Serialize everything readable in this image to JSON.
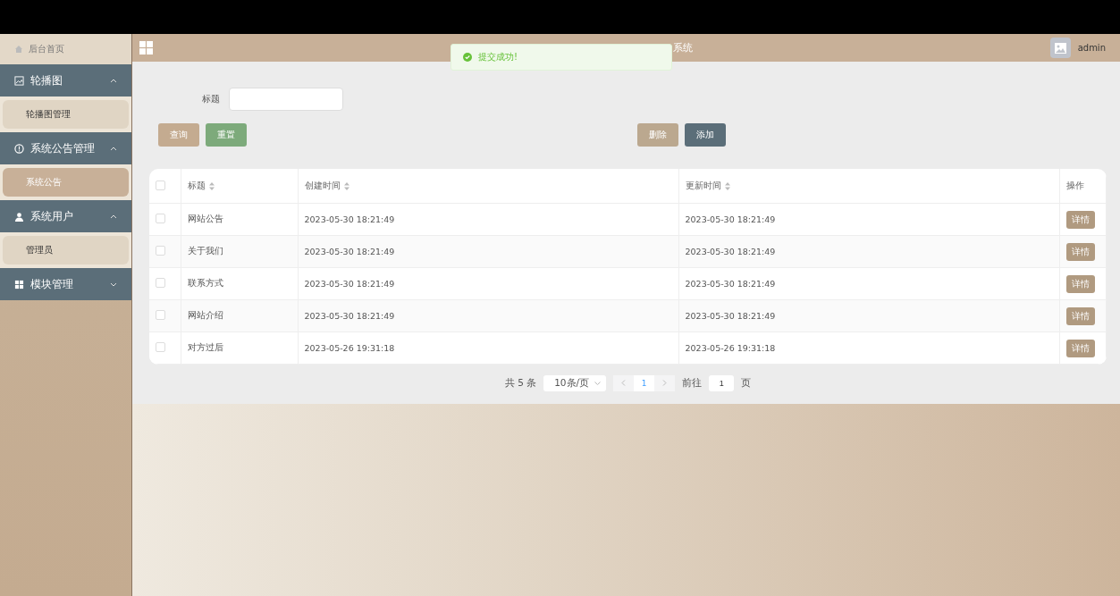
{
  "sidebar": {
    "home": {
      "label": "后台首页"
    },
    "groups": [
      {
        "label": "轮播图",
        "expanded": true,
        "children": [
          {
            "label": "轮播图管理",
            "selected": false
          }
        ]
      },
      {
        "label": "系统公告管理",
        "expanded": true,
        "children": [
          {
            "label": "系统公告",
            "selected": true
          }
        ]
      },
      {
        "label": "系统用户",
        "expanded": true,
        "children": [
          {
            "label": "管理员",
            "selected": false
          }
        ]
      },
      {
        "label": "模块管理",
        "expanded": false
      }
    ]
  },
  "header": {
    "title": "系统",
    "user": "admin"
  },
  "toast": {
    "message": "提交成功!"
  },
  "search": {
    "label": "标题"
  },
  "buttons": {
    "query": "查询",
    "reset": "重置",
    "delete": "删除",
    "add": "添加"
  },
  "table": {
    "all_checked": false,
    "columns": [
      {
        "label": "标题",
        "sortable": true
      },
      {
        "label": "创建时间",
        "sortable": true
      },
      {
        "label": "更新时间",
        "sortable": true
      },
      {
        "label": "操作",
        "sortable": false
      }
    ],
    "rows": [
      {
        "checked": false,
        "title": "网站公告",
        "created": "2023-05-30 18:21:49",
        "updated": "2023-05-30 18:21:49",
        "action": "详情"
      },
      {
        "checked": false,
        "title": "关于我们",
        "created": "2023-05-30 18:21:49",
        "updated": "2023-05-30 18:21:49",
        "action": "详情"
      },
      {
        "checked": false,
        "title": "联系方式",
        "created": "2023-05-30 18:21:49",
        "updated": "2023-05-30 18:21:49",
        "action": "详情"
      },
      {
        "checked": false,
        "title": "网站介绍",
        "created": "2023-05-30 18:21:49",
        "updated": "2023-05-30 18:21:49",
        "action": "详情"
      },
      {
        "checked": false,
        "title": "对方过后",
        "created": "2023-05-26 19:31:18",
        "updated": "2023-05-26 19:31:18",
        "action": "详情"
      }
    ]
  },
  "pagination": {
    "total": "共 5 条",
    "page_size": "10条/页",
    "pages": [
      {
        "label": "1",
        "selected": true
      }
    ],
    "goto_label": "前往",
    "goto_value": "1",
    "goto_suffix": "页"
  }
}
